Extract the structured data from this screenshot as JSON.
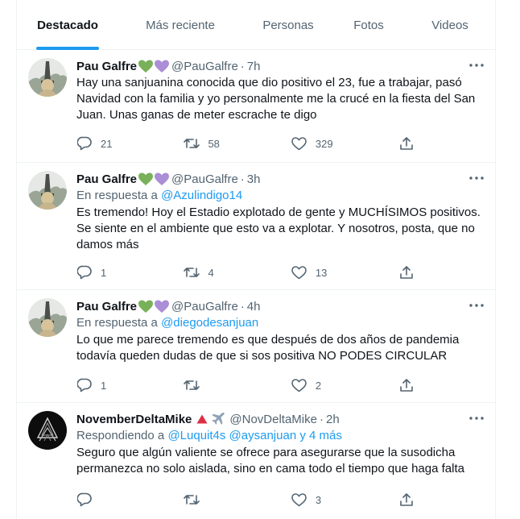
{
  "tabs": [
    {
      "label": "Destacado",
      "active": true
    },
    {
      "label": "Más reciente",
      "active": false
    },
    {
      "label": "Personas",
      "active": false
    },
    {
      "label": "Fotos",
      "active": false
    },
    {
      "label": "Videos",
      "active": false
    }
  ],
  "accent_color": "#1d9bf0",
  "tweets": [
    {
      "name": "Pau Galfre",
      "handle": "@PauGalfre",
      "separator": "·",
      "time": "7h",
      "text": "Hay una sanjuanina conocida que dio positivo el 23, fue a trabajar, pasó Navidad con la familia y yo personalmente me la crucé en la fiesta del San Juan. Unas ganas de meter escrache te digo",
      "replies": "21",
      "retweets": "58",
      "likes": "329"
    },
    {
      "name": "Pau Galfre",
      "handle": "@PauGalfre",
      "separator": "·",
      "time": "3h",
      "reply_prefix": "En respuesta a",
      "reply_users": "@Azulindigo14",
      "text": "Es tremendo! Hoy el Estadio explotado de gente y MUCHÍSIMOS positivos. Se siente en el ambiente que esto va a explotar. Y nosotros, posta, que no damos más",
      "replies": "1",
      "retweets": "4",
      "likes": "13"
    },
    {
      "name": "Pau Galfre",
      "handle": "@PauGalfre",
      "separator": "·",
      "time": "4h",
      "reply_prefix": "En respuesta a",
      "reply_users": "@diegodesanjuan",
      "text": "Lo que me parece tremendo es que después de dos años de pandemia todavía queden dudas de que si sos positiva NO PODES CIRCULAR",
      "replies": "1",
      "retweets": "",
      "likes": "2"
    },
    {
      "name": "NovemberDeltaMike",
      "handle": "@NovDeltaMike",
      "separator": "·",
      "time": "2h",
      "reply_prefix": "Respondiendo a",
      "reply_users": "@Luquit4s @aysanjuan y 4 más",
      "text": "Seguro que algún valiente se ofrece para asegurarse que la susodicha permanezca no solo aislada, sino en cama todo el tiempo que haga falta",
      "replies": "",
      "retweets": "",
      "likes": "3"
    }
  ]
}
